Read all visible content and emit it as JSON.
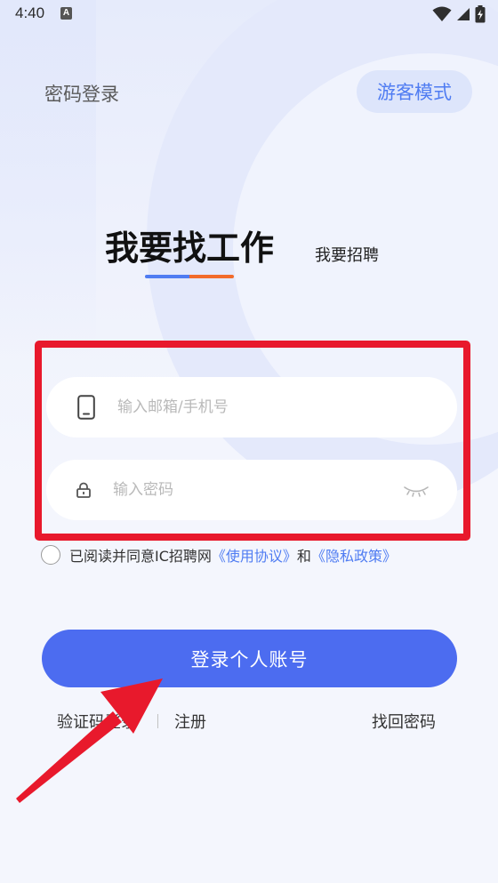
{
  "status_bar": {
    "time": "4:40",
    "notification_letter": "A",
    "icons": [
      "wifi-icon",
      "signal-icon",
      "battery-charging-icon"
    ]
  },
  "header": {
    "title": "密码登录",
    "guest_mode_label": "游客模式"
  },
  "tabs": {
    "active_label": "我要找工作",
    "inactive_label": "我要招聘"
  },
  "form": {
    "phone_placeholder": "输入邮箱/手机号",
    "phone_value": "",
    "password_placeholder": "输入密码",
    "password_value": ""
  },
  "agreement": {
    "checked": false,
    "prefix": "已阅读并同意IC招聘网",
    "terms_link": "《使用协议》",
    "and": "和",
    "privacy_link": "《隐私政策》"
  },
  "login_button_label": "登录个人账号",
  "bottom_links": {
    "code_login": "验证码登录",
    "register": "注册",
    "forgot_password": "找回密码"
  },
  "colors": {
    "primary": "#4c6cf0",
    "link": "#4f7cf2",
    "highlight": "#e8192c",
    "tab_underline_left": "#4f7cf2",
    "tab_underline_right": "#f26b2a",
    "annotation_arrow": "#e8192c"
  }
}
